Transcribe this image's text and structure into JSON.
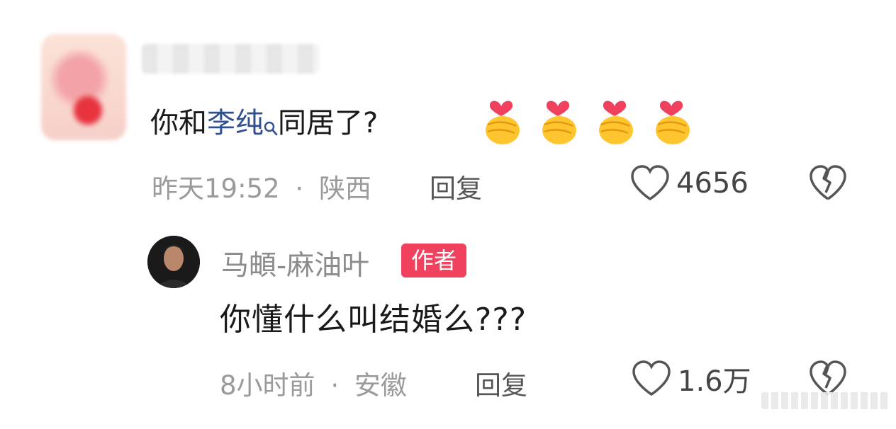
{
  "comment": {
    "text_before": "你和",
    "mention": "李纯",
    "text_after": "同居了?",
    "emoji_names": [
      "finger-heart-emoji",
      "finger-heart-emoji",
      "finger-heart-emoji",
      "finger-heart-emoji"
    ],
    "time": "昨天19:52",
    "separator": "·",
    "location": "陕西",
    "reply_label": "回复",
    "like_count": "4656"
  },
  "reply": {
    "author": "马頔-麻油叶",
    "author_badge": "作者",
    "text": "你懂什么叫结婚么???",
    "time": "8小时前",
    "separator": "·",
    "location": "安徽",
    "reply_label": "回复",
    "like_count": "1.6万"
  },
  "colors": {
    "mention": "#2f4f8f",
    "badge": "#f0425f",
    "meta": "#9a9a9a"
  }
}
